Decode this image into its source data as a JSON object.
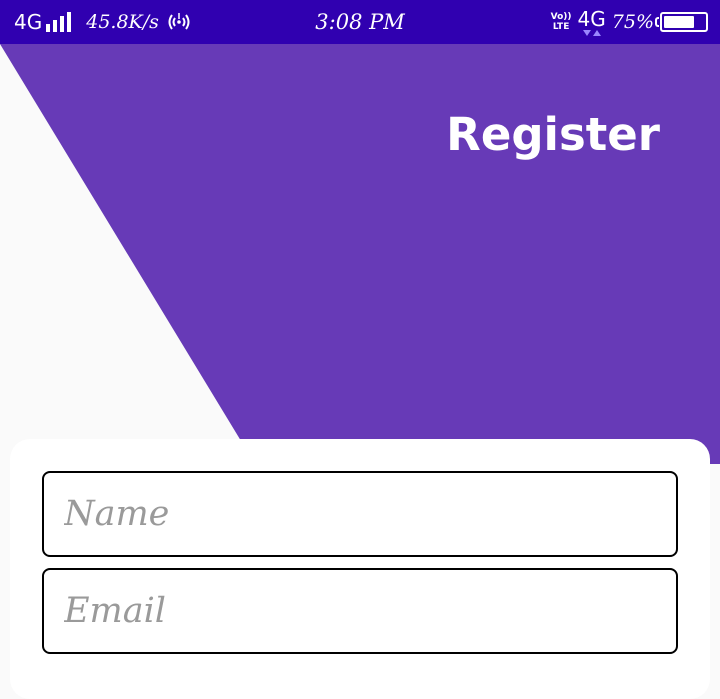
{
  "status_bar": {
    "network_left": "4G",
    "speed": "45.8K/s",
    "time": "3:08 PM",
    "volte_top": "Vo))",
    "volte_bottom": "LTE",
    "network_right": "4G",
    "battery_percent": "75%",
    "battery_level": 0.75,
    "icons": [
      "signal-bars-icon",
      "hotspot-icon",
      "volte-icon",
      "data-arrows-icon",
      "battery-icon"
    ]
  },
  "header": {
    "title": "Register"
  },
  "form": {
    "name": {
      "placeholder": "Name",
      "value": ""
    },
    "email": {
      "placeholder": "Email",
      "value": ""
    }
  },
  "colors": {
    "status_bar": "#3000b0",
    "header": "#673ab7",
    "background": "#fafafa",
    "card": "#ffffff",
    "placeholder": "#9a9a9a",
    "field_border": "#000000"
  }
}
